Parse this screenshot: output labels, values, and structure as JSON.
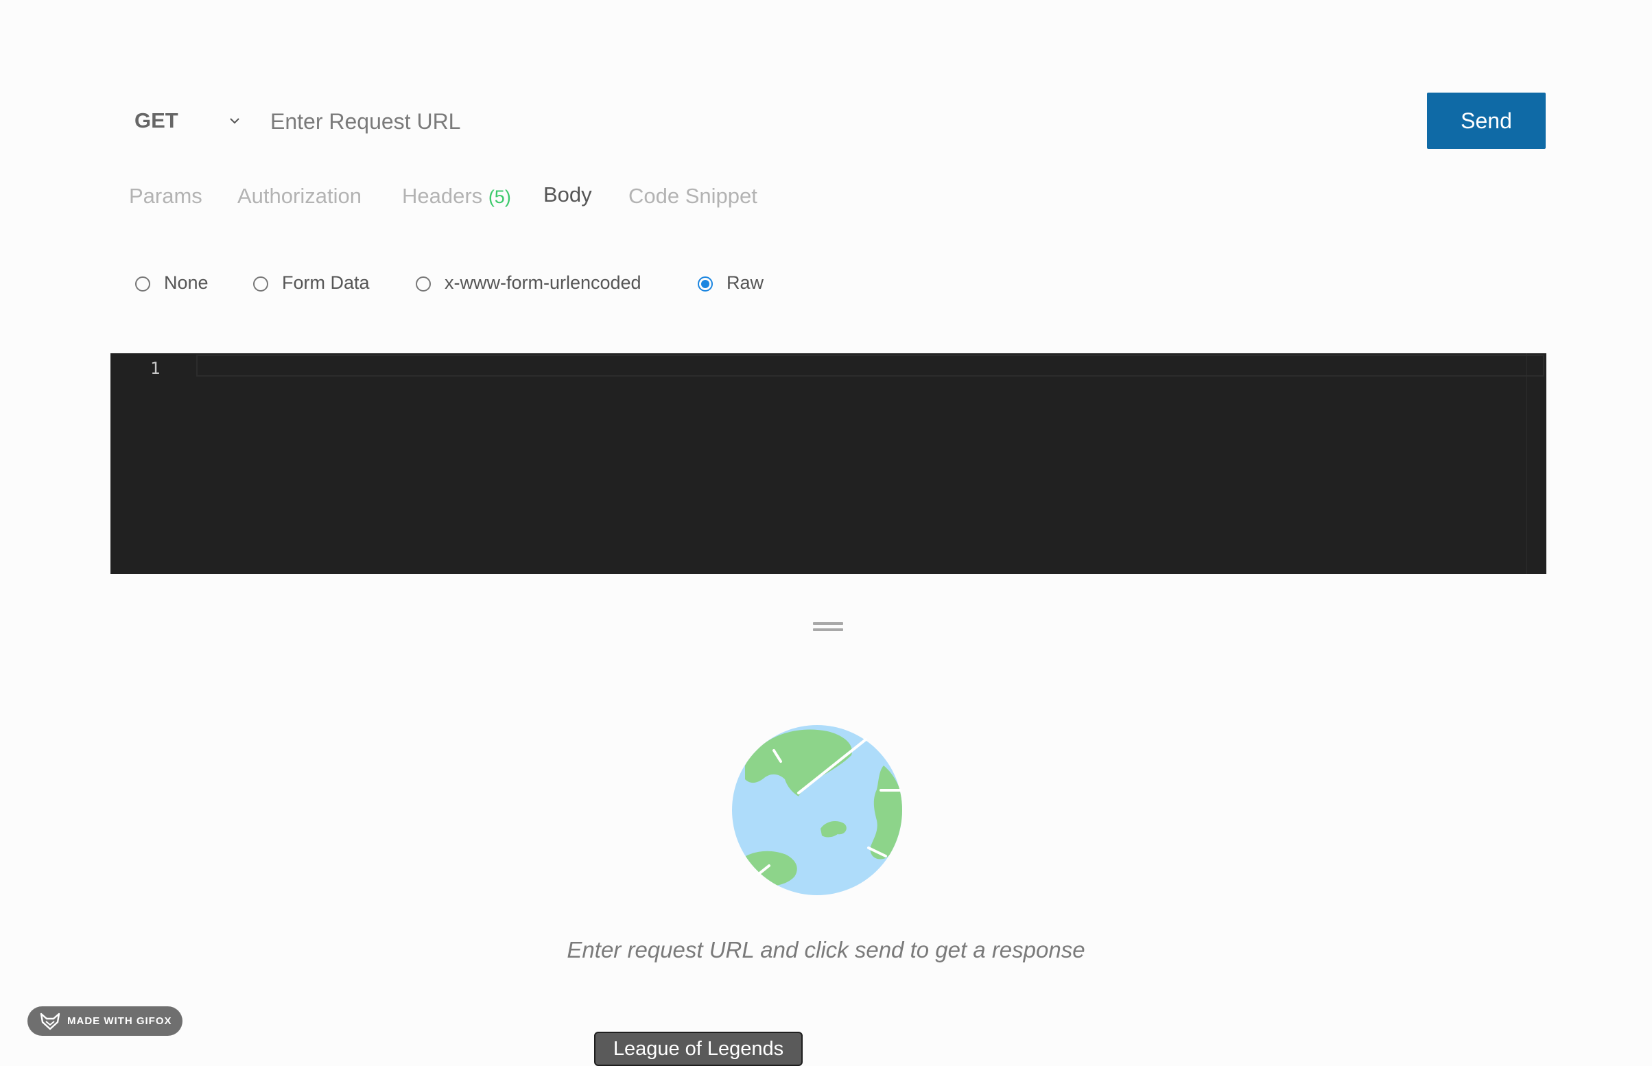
{
  "request": {
    "method": "GET",
    "url_placeholder": "Enter Request URL",
    "url_value": "",
    "send_label": "Send"
  },
  "tabs": [
    {
      "label": "Params"
    },
    {
      "label": "Authorization"
    },
    {
      "label": "Headers",
      "count": "(5)"
    },
    {
      "label": "Body",
      "active": true
    },
    {
      "label": "Code Snippet"
    }
  ],
  "body_types": [
    {
      "label": "None",
      "checked": false
    },
    {
      "label": "Form Data",
      "checked": false
    },
    {
      "label": "x-www-form-urlencoded",
      "checked": false
    },
    {
      "label": "Raw",
      "checked": true
    }
  ],
  "editor": {
    "line_numbers": [
      "1"
    ],
    "content": ""
  },
  "response": {
    "empty_message": "Enter request URL and click send to get a response",
    "icon": "globe-illustration"
  },
  "overlays": {
    "badge_text": "MADE WITH GIFOX",
    "tooltip_text": "League of Legends"
  },
  "colors": {
    "accent": "#0f6aa6",
    "radio_checked": "#1a85e0",
    "headers_count": "#3cc96b",
    "editor_bg": "#212121",
    "globe_water": "#aedcfa",
    "globe_land": "#8dd48a"
  }
}
